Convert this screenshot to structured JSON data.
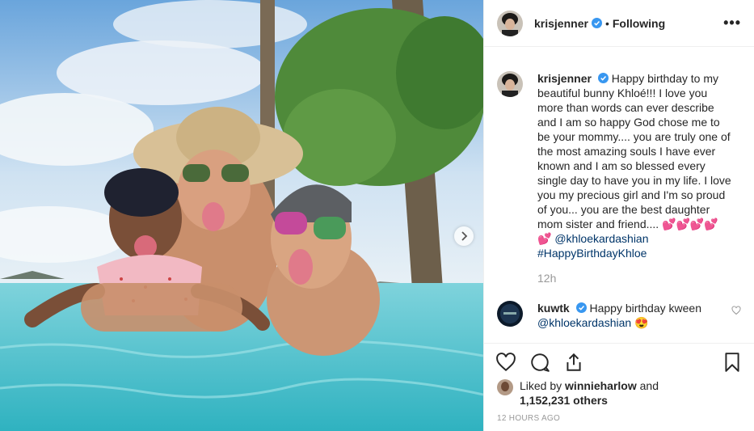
{
  "post": {
    "author": "krisjenner",
    "follow_status": "Following",
    "separator": "•",
    "more_label": "•••"
  },
  "caption": {
    "username": "krisjenner",
    "text": "Happy birthday to my beautiful bunny Khloé!!! I love you more than words can ever describe and I am so happy God chose me to be your mommy.... you are truly one of the most amazing souls I have ever known and I am so blessed every single day to have you in my life. I love you my precious girl and I'm so proud of you... you are the best daughter mom sister and friend.... 💕💕💕💕💕 ",
    "mention": "@khloekardashian",
    "hashtag": "#HappyBirthdayKhloe",
    "time": "12h"
  },
  "comment": {
    "username": "kuwtk",
    "text": "Happy birthday kween",
    "mention": "@khloekardashian",
    "emoji": "😍"
  },
  "likes": {
    "prefix": "Liked by ",
    "user": "winnieharlow",
    "middle": " and",
    "count": "1,152,231 others"
  },
  "timestamp": "12 HOURS AGO",
  "icons": [
    "verified-badge-icon",
    "more-options-icon",
    "heart-icon",
    "comment-icon",
    "share-icon",
    "bookmark-icon",
    "chevron-right-icon"
  ],
  "colors": {
    "verified": "#3897f0",
    "link": "#003569",
    "muted": "#999999"
  }
}
